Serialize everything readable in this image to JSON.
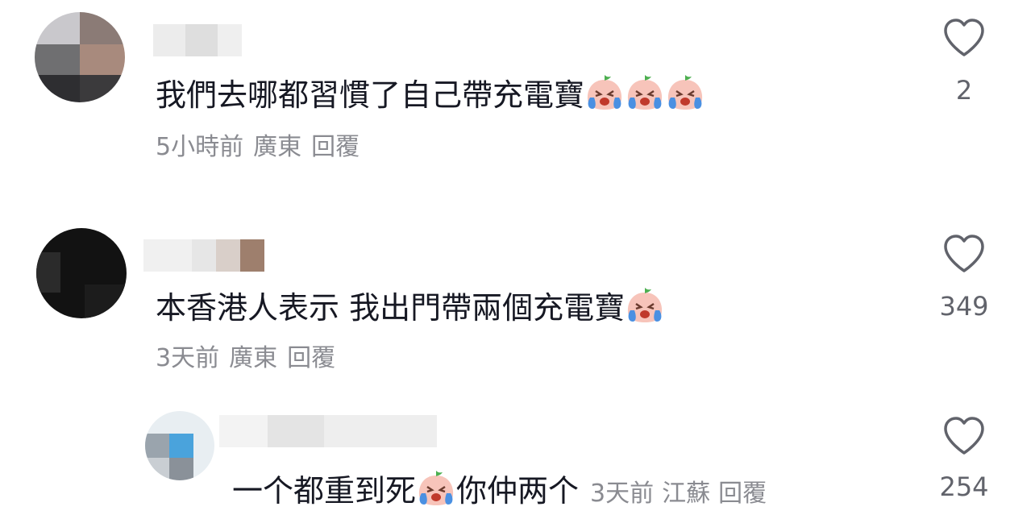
{
  "comments": [
    {
      "text": "我們去哪都習慣了自己帶充電寶",
      "emoji_count": 3,
      "time": "5小時前",
      "location": "廣東",
      "reply_label": "回覆",
      "likes": "2"
    },
    {
      "text": "本香港人表示 我出門帶兩個充電寶",
      "emoji_count": 1,
      "time": "3天前",
      "location": "廣東",
      "reply_label": "回覆",
      "likes": "349"
    },
    {
      "text_before": "一个都重到死",
      "text_after": "你仲两个",
      "time": "3天前",
      "location": "江蘇",
      "reply_label": "回覆",
      "likes": "254"
    }
  ],
  "icons": {
    "like": "heart-outline-icon",
    "emoji": "loudly-crying-face-emoji"
  },
  "colors": {
    "text": "#161823",
    "meta": "#8a8b91",
    "icon": "#61636b"
  }
}
